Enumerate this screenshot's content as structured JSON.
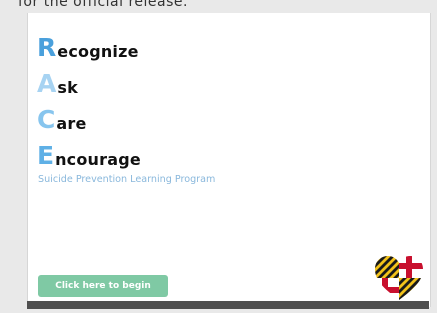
{
  "caption": "for the official release.",
  "race": [
    {
      "letter": "R",
      "rest": "ecognize",
      "color": "#4aa0dc"
    },
    {
      "letter": "A",
      "rest": "sk",
      "color": "#a7d3f2"
    },
    {
      "letter": "C",
      "rest": "are",
      "color": "#87c5ee"
    },
    {
      "letter": "E",
      "rest": "ncourage",
      "color": "#5fb0e6"
    }
  ],
  "subtitle": "Suicide Prevention Learning Program",
  "start_button": {
    "label": "Click here to begin",
    "color": "#7fc9a4"
  },
  "logo": {
    "icon": "maryland-flag-heart-icon"
  }
}
